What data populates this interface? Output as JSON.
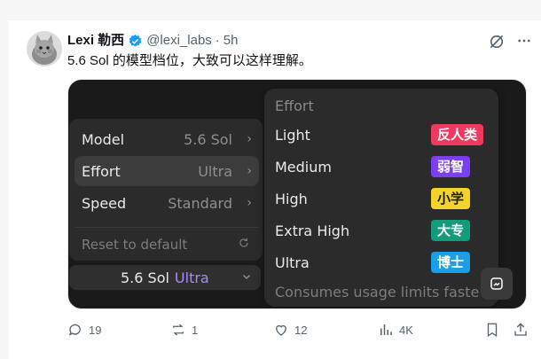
{
  "tweet": {
    "name": "Lexi 勒西",
    "handle": "@lexi_labs",
    "separator": "·",
    "time": "5h",
    "text": "5.6 Sol 的模型档位，大致可以这样理解。"
  },
  "model_menu": {
    "rows": [
      {
        "label": "Model",
        "value": "5.6 Sol",
        "active": false
      },
      {
        "label": "Effort",
        "value": "Ultra",
        "active": true
      },
      {
        "label": "Speed",
        "value": "Standard",
        "active": false
      }
    ],
    "reset_label": "Reset to default",
    "selector": {
      "model": "5.6 Sol",
      "tier": "Ultra"
    }
  },
  "effort_menu": {
    "title": "Effort",
    "options": [
      {
        "label": "Light",
        "badge": "反人类",
        "badge_bg": "#f0395f",
        "badge_fg": "#ffffff"
      },
      {
        "label": "Medium",
        "badge": "弱智",
        "badge_bg": "#7b3ff2",
        "badge_fg": "#ffffff"
      },
      {
        "label": "High",
        "badge": "小学",
        "badge_bg": "#f5d328",
        "badge_fg": "#1a1a1a"
      },
      {
        "label": "Extra High",
        "badge": "大专",
        "badge_bg": "#149c7a",
        "badge_fg": "#ffffff"
      },
      {
        "label": "Ultra",
        "badge": "博士",
        "badge_bg": "#1a9ee8",
        "badge_fg": "#ffffff"
      }
    ],
    "footer": "Consumes usage limits faste"
  },
  "actions": {
    "replies": "19",
    "reposts": "1",
    "likes": "12",
    "views": "4K"
  },
  "colors": {
    "verified": "#1d9bf0",
    "tier_accent": "#a78bfa"
  }
}
